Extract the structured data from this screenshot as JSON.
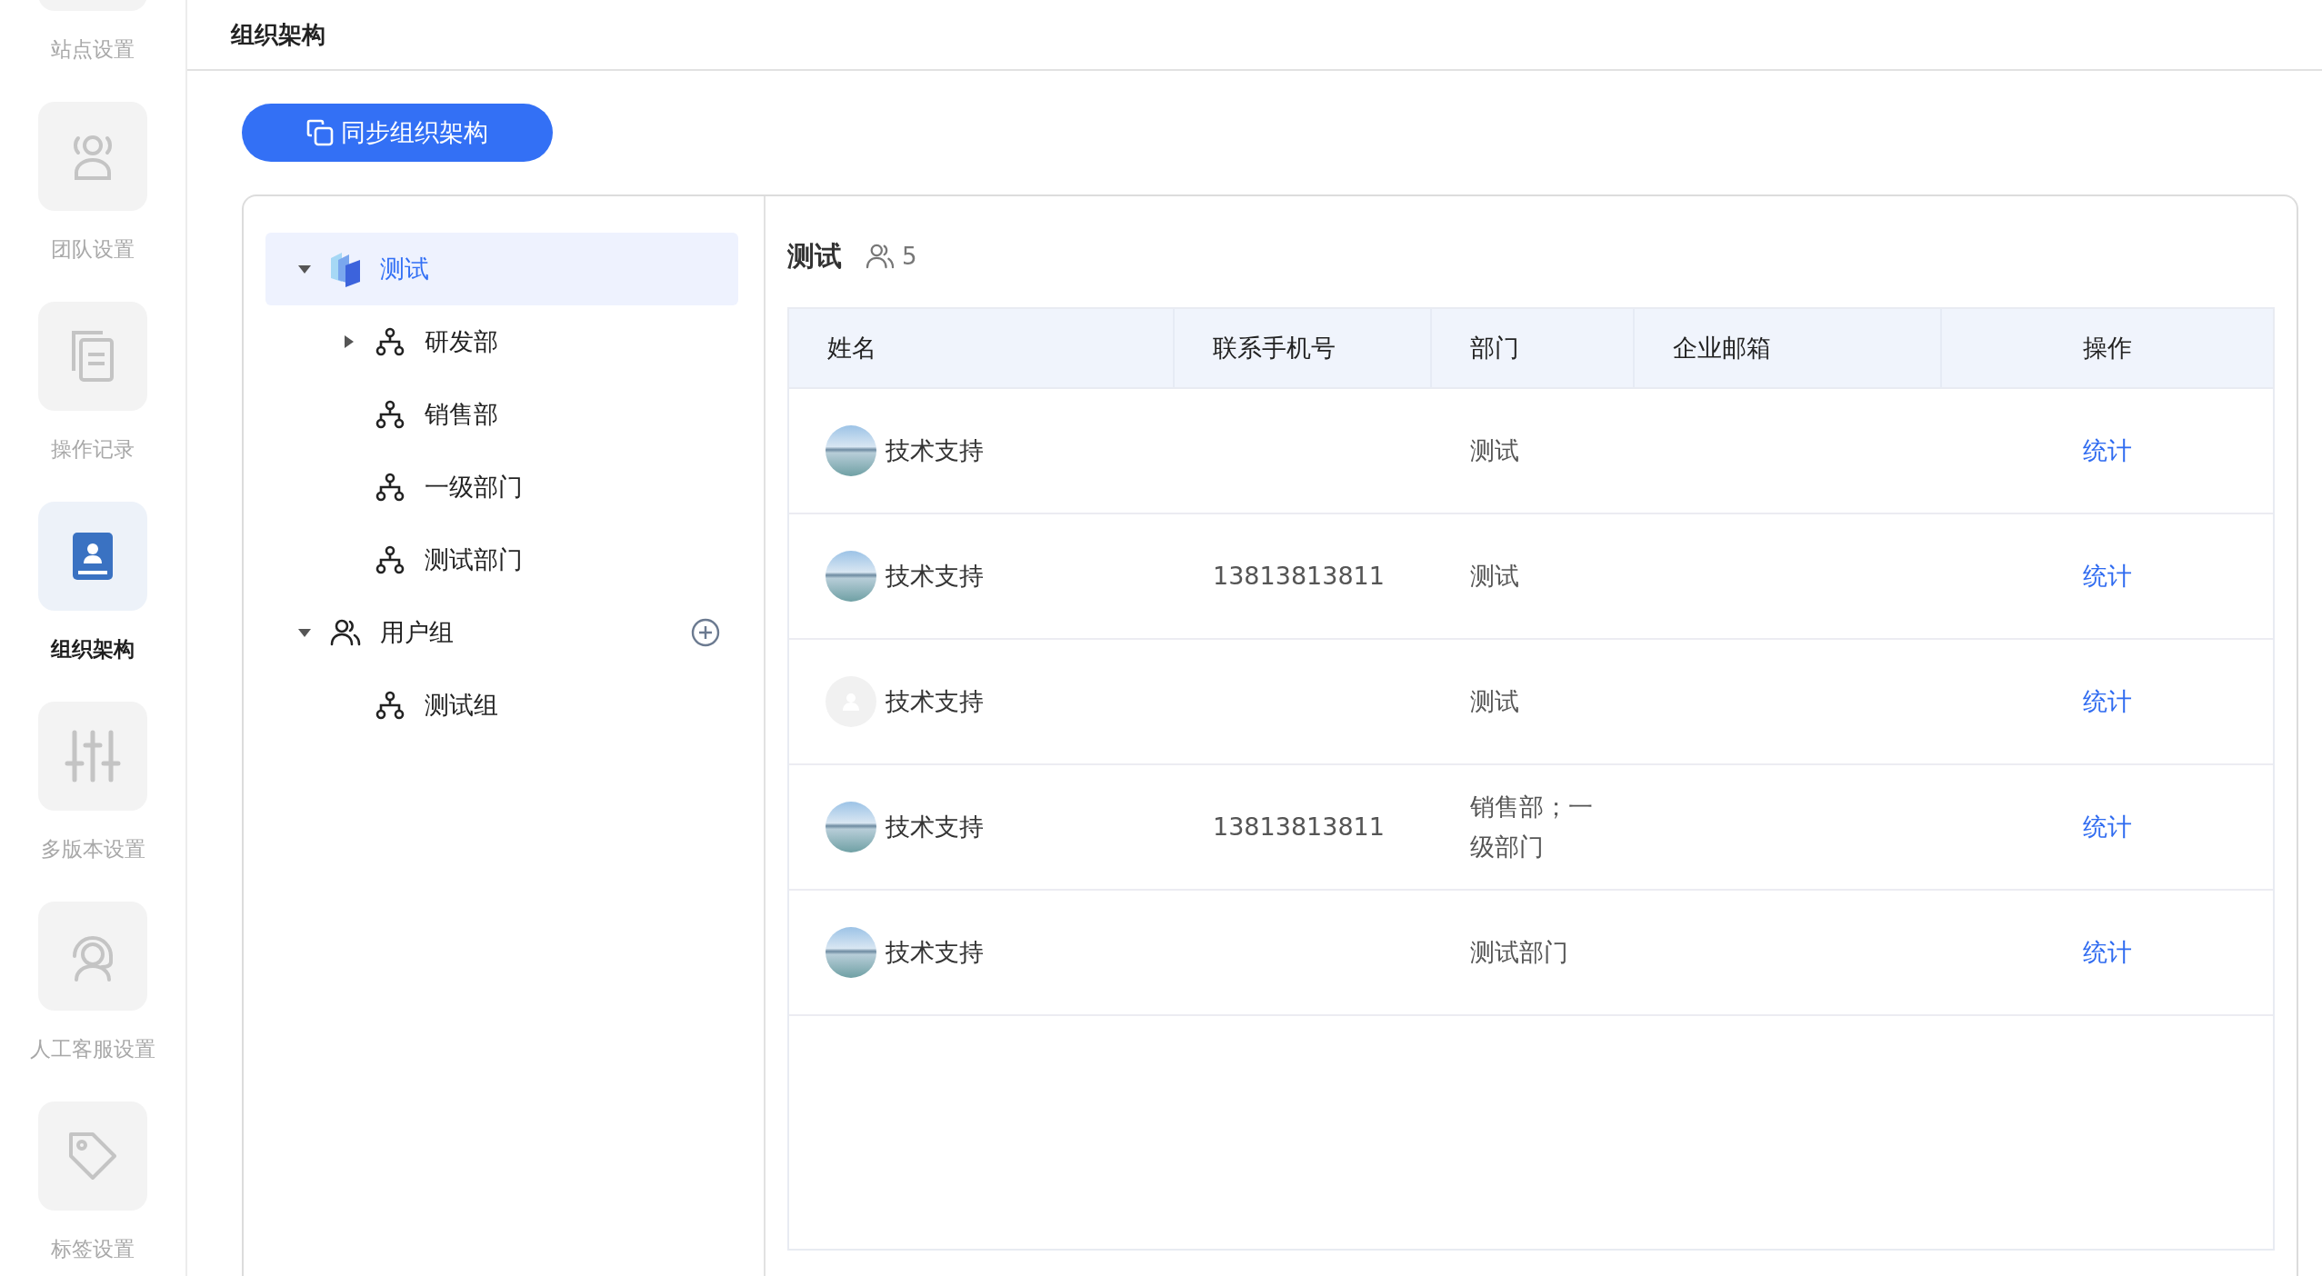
{
  "sidebar": {
    "items": [
      {
        "label": "站点设置",
        "kind": "site",
        "selected": false
      },
      {
        "label": "团队设置",
        "kind": "team",
        "selected": false
      },
      {
        "label": "操作记录",
        "kind": "records",
        "selected": false
      },
      {
        "label": "组织架构",
        "kind": "org",
        "selected": true
      },
      {
        "label": "多版本设置",
        "kind": "versions",
        "selected": false
      },
      {
        "label": "人工客服设置",
        "kind": "service",
        "selected": false
      },
      {
        "label": "标签设置",
        "kind": "tag",
        "selected": false
      }
    ]
  },
  "page_title": "组织架构",
  "sync_button": {
    "label": "同步组织架构"
  },
  "tree": [
    {
      "label": "测试",
      "kind": "root",
      "selected": true,
      "expanded": true,
      "children": [
        {
          "label": "研发部",
          "kind": "dept",
          "selected": false,
          "expanded": false
        },
        {
          "label": "销售部",
          "kind": "dept",
          "selected": false
        },
        {
          "label": "一级部门",
          "kind": "dept",
          "selected": false
        },
        {
          "label": "测试部门",
          "kind": "dept",
          "selected": false
        }
      ]
    },
    {
      "label": "用户组",
      "kind": "group",
      "selected": false,
      "expanded": true,
      "add_button": true,
      "children": [
        {
          "label": "测试组",
          "kind": "dept",
          "selected": false
        }
      ]
    }
  ],
  "members": {
    "title": "测试",
    "count": "5",
    "columns": [
      "姓名",
      "联系手机号",
      "部门",
      "企业邮箱",
      "操作"
    ],
    "rows": [
      {
        "name": "技术支持",
        "kind": "photo",
        "department": "测试",
        "action": "统计"
      },
      {
        "name": "技术支持",
        "kind": "photo",
        "phone": "13813813811",
        "department": "测试",
        "action": "统计"
      },
      {
        "name": "技术支持",
        "kind": "default",
        "department": "测试",
        "action": "统计"
      },
      {
        "name": "技术支持",
        "kind": "photo",
        "phone": "13813813811",
        "department": "销售部；一级部门",
        "action": "统计"
      },
      {
        "name": "技术支持",
        "kind": "photo",
        "department": "测试部门",
        "action": "统计"
      }
    ]
  }
}
